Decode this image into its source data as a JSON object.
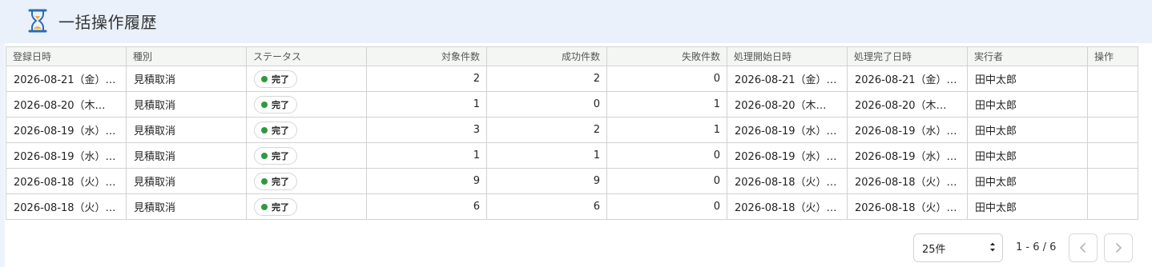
{
  "header": {
    "title": "一括操作履歴",
    "icon": "hourglass-icon"
  },
  "table": {
    "columns": [
      "登録日時",
      "種別",
      "ステータス",
      "対象件数",
      "成功件数",
      "失敗件数",
      "処理開始日時",
      "処理完了日時",
      "実行者",
      "操作"
    ],
    "rows": [
      {
        "registered": "2026-08-21（金）…",
        "type": "見積取消",
        "status": "完了",
        "target": "2",
        "success": "2",
        "failed": "0",
        "started": "2026-08-21（金）…",
        "completed": "2026-08-21（金）…",
        "executor": "田中太郎",
        "action": ""
      },
      {
        "registered": "2026-08-20（木…",
        "type": "見積取消",
        "status": "完了",
        "target": "1",
        "success": "0",
        "failed": "1",
        "started": "2026-08-20（木…",
        "completed": "2026-08-20（木…",
        "executor": "田中太郎",
        "action": ""
      },
      {
        "registered": "2026-08-19（水）…",
        "type": "見積取消",
        "status": "完了",
        "target": "3",
        "success": "2",
        "failed": "1",
        "started": "2026-08-19（水）…",
        "completed": "2026-08-19（水）…",
        "executor": "田中太郎",
        "action": ""
      },
      {
        "registered": "2026-08-19（水）…",
        "type": "見積取消",
        "status": "完了",
        "target": "1",
        "success": "1",
        "failed": "0",
        "started": "2026-08-19（水）…",
        "completed": "2026-08-19（水）…",
        "executor": "田中太郎",
        "action": ""
      },
      {
        "registered": "2026-08-18（火）…",
        "type": "見積取消",
        "status": "完了",
        "target": "9",
        "success": "9",
        "failed": "0",
        "started": "2026-08-18（火）…",
        "completed": "2026-08-18（火）…",
        "executor": "田中太郎",
        "action": ""
      },
      {
        "registered": "2026-08-18（火）…",
        "type": "見積取消",
        "status": "完了",
        "target": "6",
        "success": "6",
        "failed": "0",
        "started": "2026-08-18（火）…",
        "completed": "2026-08-18（火）…",
        "executor": "田中太郎",
        "action": ""
      }
    ]
  },
  "pagination": {
    "page_size": "25件",
    "range": "1 - 6 / 6"
  },
  "colors": {
    "header_bg": "#eaf1fb",
    "hourglass": "#2a6bb8",
    "status_dot": "#2e9a3f"
  }
}
